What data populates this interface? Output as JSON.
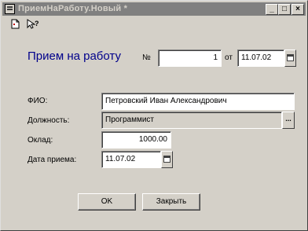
{
  "window": {
    "title": "ПриемНаРаботу.Новый *",
    "controls": [
      "_",
      "□",
      "×"
    ]
  },
  "toolbar": {
    "icons": [
      "document-icon",
      "help-pointer-icon"
    ]
  },
  "form": {
    "title": "Прием на работу",
    "number_label": "№",
    "number_value": "1",
    "date_label": "от",
    "date_value": "11.07.02",
    "fio_label": "ФИО:",
    "fio_value": "Петровский Иван Александрович",
    "position_label": "Должность:",
    "position_value": "Программист",
    "position_button": "...",
    "salary_label": "Оклад:",
    "salary_value": "1000.00",
    "hire_date_label": "Дата приема:",
    "hire_date_value": "11.07.02"
  },
  "buttons": {
    "ok": "OK",
    "close": "Закрыть"
  }
}
